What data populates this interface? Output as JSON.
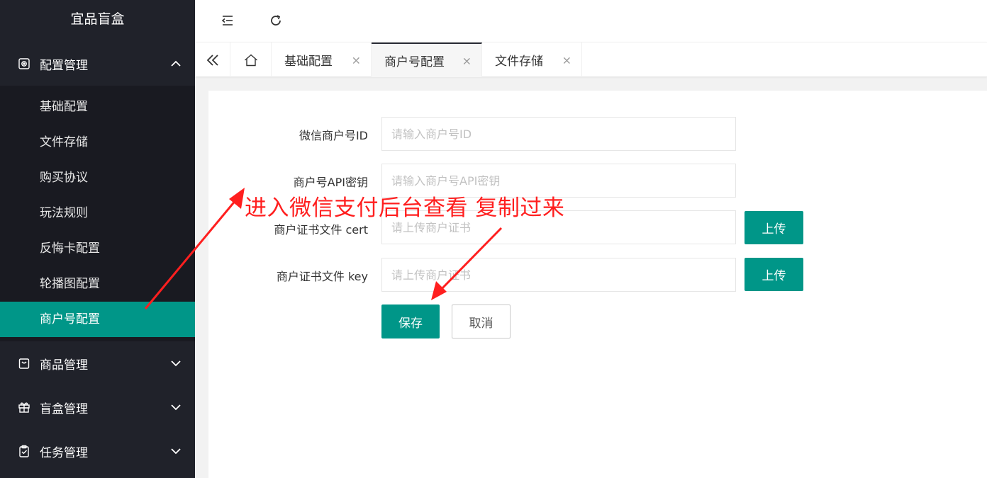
{
  "brand": {
    "title": "宜品盲盒"
  },
  "sidebar": {
    "config_group": {
      "label": "配置管理",
      "icon": "settings-icon",
      "items": [
        {
          "label": "基础配置"
        },
        {
          "label": "文件存储"
        },
        {
          "label": "购买协议"
        },
        {
          "label": "玩法规则"
        },
        {
          "label": "反悔卡配置"
        },
        {
          "label": "轮播图配置"
        },
        {
          "label": "商户号配置",
          "active": true
        }
      ]
    },
    "groups": [
      {
        "label": "商品管理",
        "icon": "bag-icon"
      },
      {
        "label": "盲盒管理",
        "icon": "gift-icon"
      },
      {
        "label": "任务管理",
        "icon": "clipboard-icon"
      }
    ]
  },
  "header": {
    "shrink_icon": "menu-fold-icon",
    "refresh_icon": "refresh-icon"
  },
  "tabs": {
    "prev_icon": "double-chevron-left-icon",
    "home_icon": "home-icon",
    "items": [
      {
        "label": "基础配置",
        "close": "×"
      },
      {
        "label": "商户号配置",
        "close": "×",
        "active": true
      },
      {
        "label": "文件存储",
        "close": "×"
      }
    ]
  },
  "form": {
    "mch_id": {
      "label": "微信商户号ID",
      "placeholder": "请输入商户号ID",
      "value": ""
    },
    "api_key": {
      "label": "商户号API密钥",
      "placeholder": "请输入商户号API密钥",
      "value": ""
    },
    "cert": {
      "label": "商户证书文件 cert",
      "placeholder": "请上传商户证书",
      "value": "",
      "upload_label": "上传"
    },
    "key": {
      "label": "商户证书文件 key",
      "placeholder": "请上传商户证书",
      "value": "",
      "upload_label": "上传"
    },
    "save_label": "保存",
    "cancel_label": "取消"
  },
  "annotation": {
    "text": "进入微信支付后台查看 复制过来",
    "color": "#ff1f1f"
  },
  "colors": {
    "accent": "#009688",
    "sidebar_bg": "#20222a",
    "submenu_bg": "#191a21"
  }
}
